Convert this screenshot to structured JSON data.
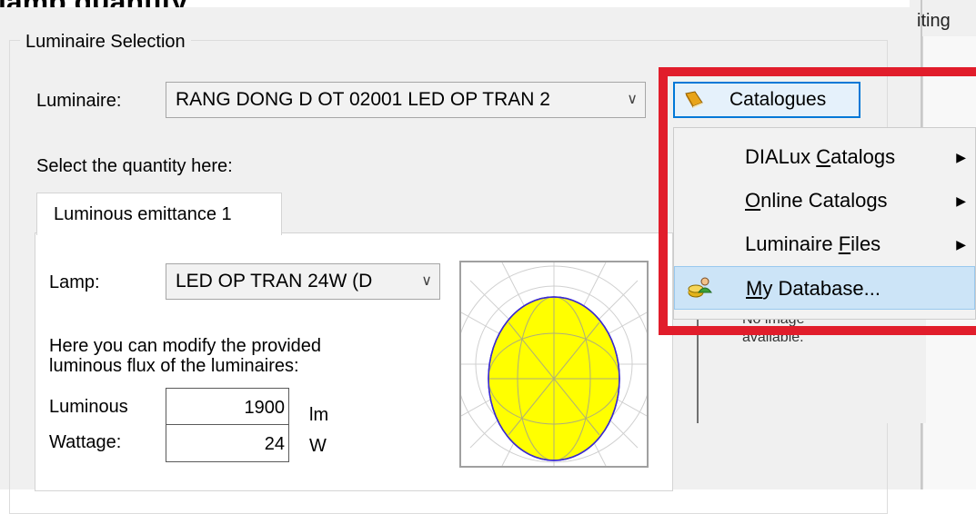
{
  "header_fragment": "lamp quantity",
  "right_fragment": "iting",
  "luminaire_selection": {
    "group_title": "Luminaire Selection",
    "luminaire_label": "Luminaire:",
    "luminaire_value": "RANG DONG D OT 02001 LED OP TRAN 2",
    "quantity_prompt": "Select the quantity here:",
    "catalogues_button": "Catalogues"
  },
  "tab": {
    "label": "Luminous emittance 1"
  },
  "lamp": {
    "label": "Lamp:",
    "value": "LED OP TRAN 24W (D",
    "flux_note_line1": "Here you can modify the provided",
    "flux_note_line2": "luminous flux of the luminaires:",
    "luminous_label": "Luminous",
    "luminous_value": "1900",
    "luminous_unit": "lm",
    "wattage_label": "Wattage:",
    "wattage_value": "24",
    "wattage_unit": "W"
  },
  "no_image": {
    "line1": "No image",
    "line2": "available."
  },
  "catalogues_menu": {
    "items": [
      {
        "label_pre": "DIALux ",
        "label_accel": "C",
        "label_post": "atalogs",
        "submenu": true
      },
      {
        "label_pre": "",
        "label_accel": "O",
        "label_post": "nline Catalogs",
        "submenu": true
      },
      {
        "label_pre": "Luminaire ",
        "label_accel": "F",
        "label_post": "iles",
        "submenu": true
      },
      {
        "label_pre": "",
        "label_accel": "M",
        "label_post": "y Database...",
        "submenu": false
      }
    ],
    "highlighted_index": 3
  },
  "colors": {
    "highlight_red": "#e11d2b",
    "menu_highlight": "#cce4f7",
    "button_focus": "#0078d7",
    "diagram_fill": "#ffff00",
    "diagram_outline": "#3a2ad0"
  },
  "icons": {
    "catalogues": "book-icon",
    "my_database": "database-users-icon",
    "submenu": "triangle-right-icon",
    "dropdown": "chevron-down-icon"
  }
}
